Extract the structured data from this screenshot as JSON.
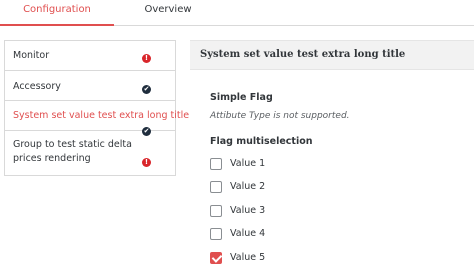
{
  "tabs": [
    {
      "label": "Configuration",
      "active": true
    },
    {
      "label": "Overview",
      "active": false
    }
  ],
  "groups": [
    {
      "label": "Monitor",
      "status": "error"
    },
    {
      "label": "Accessory",
      "status": "complete"
    },
    {
      "label": "System set value test extra long title",
      "status": "complete",
      "selected": true
    },
    {
      "label": "Group to test static delta prices rendering",
      "status": "error"
    }
  ],
  "status_icons": {
    "error": "!",
    "complete": "✔"
  },
  "panel": {
    "title": "System set value test extra long title",
    "attributes": [
      {
        "name": "Simple Flag",
        "note": "Attibute Type is not supported."
      },
      {
        "name": "Flag multiselection",
        "options": [
          {
            "label": "Value 1",
            "checked": false
          },
          {
            "label": "Value 2",
            "checked": false
          },
          {
            "label": "Value 3",
            "checked": false
          },
          {
            "label": "Value 4",
            "checked": false
          },
          {
            "label": "Value 5",
            "checked": true
          }
        ]
      }
    ]
  },
  "colors": {
    "accent": "#e04f4f",
    "error": "#d9262b",
    "complete": "#1f2d3d"
  }
}
